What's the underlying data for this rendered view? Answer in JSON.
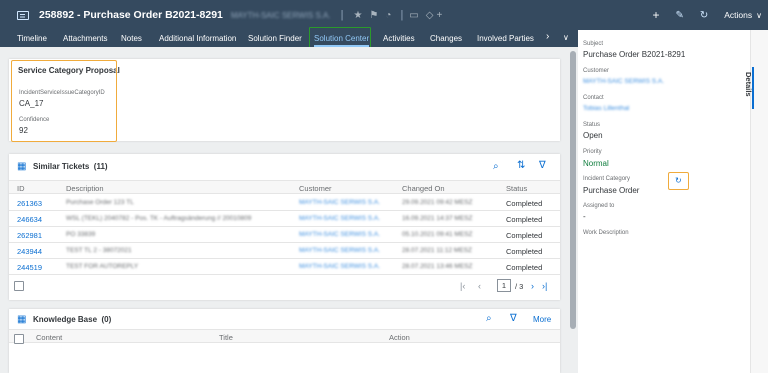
{
  "shell": {
    "title": "258892 - Purchase Order B2021-8291",
    "blurred_account": "MAYTH-SAIC SERWIS S.A.",
    "actions_label": "Actions",
    "icons": [
      "document-icon",
      "star-icon",
      "flag-icon",
      "feed-icon",
      "comment-icon",
      "tag-icon",
      "add-icon",
      "edit-icon",
      "refresh-icon",
      "add-icon"
    ]
  },
  "tabs": [
    "Timeline",
    "Attachments",
    "Notes",
    "Additional Information",
    "Solution Finder",
    "Solution Center",
    "Activities",
    "Changes",
    "Involved Parties"
  ],
  "active_tab": "Solution Center",
  "service_category": {
    "title": "Service Category Proposal",
    "field1_label": "IncidentServiceIssueCategoryID",
    "field1_value": "CA_17",
    "field2_label": "Confidence",
    "field2_value": "92"
  },
  "similar_tickets": {
    "title": "Similar Tickets",
    "count": "(11)",
    "columns": [
      "ID",
      "Description",
      "Customer",
      "Changed On",
      "Status"
    ],
    "rows": [
      {
        "id": "261363",
        "description": "Purchase Order 123 TL",
        "customer": "MAYTH-SAIC SERWIS S.A.",
        "changed_on": "29.09.2021 09:42 MESZ",
        "status": "Completed"
      },
      {
        "id": "246634",
        "description": "WSL (TEKL) 2040782 - Pos. TK - Auftragsänderung // 20010809",
        "customer": "MAYTH-SAIC SERWIS S.A.",
        "changed_on": "16.09.2021 14:37 MESZ",
        "status": "Completed"
      },
      {
        "id": "262981",
        "description": "PO 33839",
        "customer": "MAYTH-SAIC SERWIS S.A.",
        "changed_on": "05.10.2021 09:41 MESZ",
        "status": "Completed"
      },
      {
        "id": "243944",
        "description": "TEST TL 2 - 38072021",
        "customer": "MAYTH-SAIC SERWIS S.A.",
        "changed_on": "28.07.2021 11:12 MESZ",
        "status": "Completed"
      },
      {
        "id": "244519",
        "description": "TEST FOR AUTOREPLY",
        "customer": "MAYTH-SAIC SERWIS S.A.",
        "changed_on": "28.07.2021 13:46 MESZ",
        "status": "Completed"
      }
    ],
    "pager_current": "1",
    "pager_total": "/ 3"
  },
  "knowledge_base": {
    "title": "Knowledge Base",
    "count": "(0)",
    "more_label": "More",
    "columns": [
      "Content",
      "Title",
      "Action"
    ]
  },
  "details": {
    "tab_label": "Details",
    "subject_label": "Subject",
    "subject_value": "Purchase Order B2021-8291",
    "customer_label": "Customer",
    "customer_value": "MAYTH-SAIC SERWIS S.A.",
    "contact_label": "Contact",
    "contact_value": "Tobias Lillenthal",
    "status_label": "Status",
    "status_value": "Open",
    "priority_label": "Priority",
    "priority_value": "Normal",
    "incident_category_label": "Incident Category",
    "incident_category_value": "Purchase Order",
    "assigned_to_label": "Assigned to",
    "assigned_to_value": "-",
    "work_description_label": "Work Description"
  },
  "colors": {
    "shell_bg": "#354a5f",
    "link": "#0a6ed1",
    "active_tab": "#91c8f6",
    "highlight_orange": "#f0ab3c",
    "highlight_green": "#2b9a2b",
    "priority_green": "#107e3e"
  }
}
